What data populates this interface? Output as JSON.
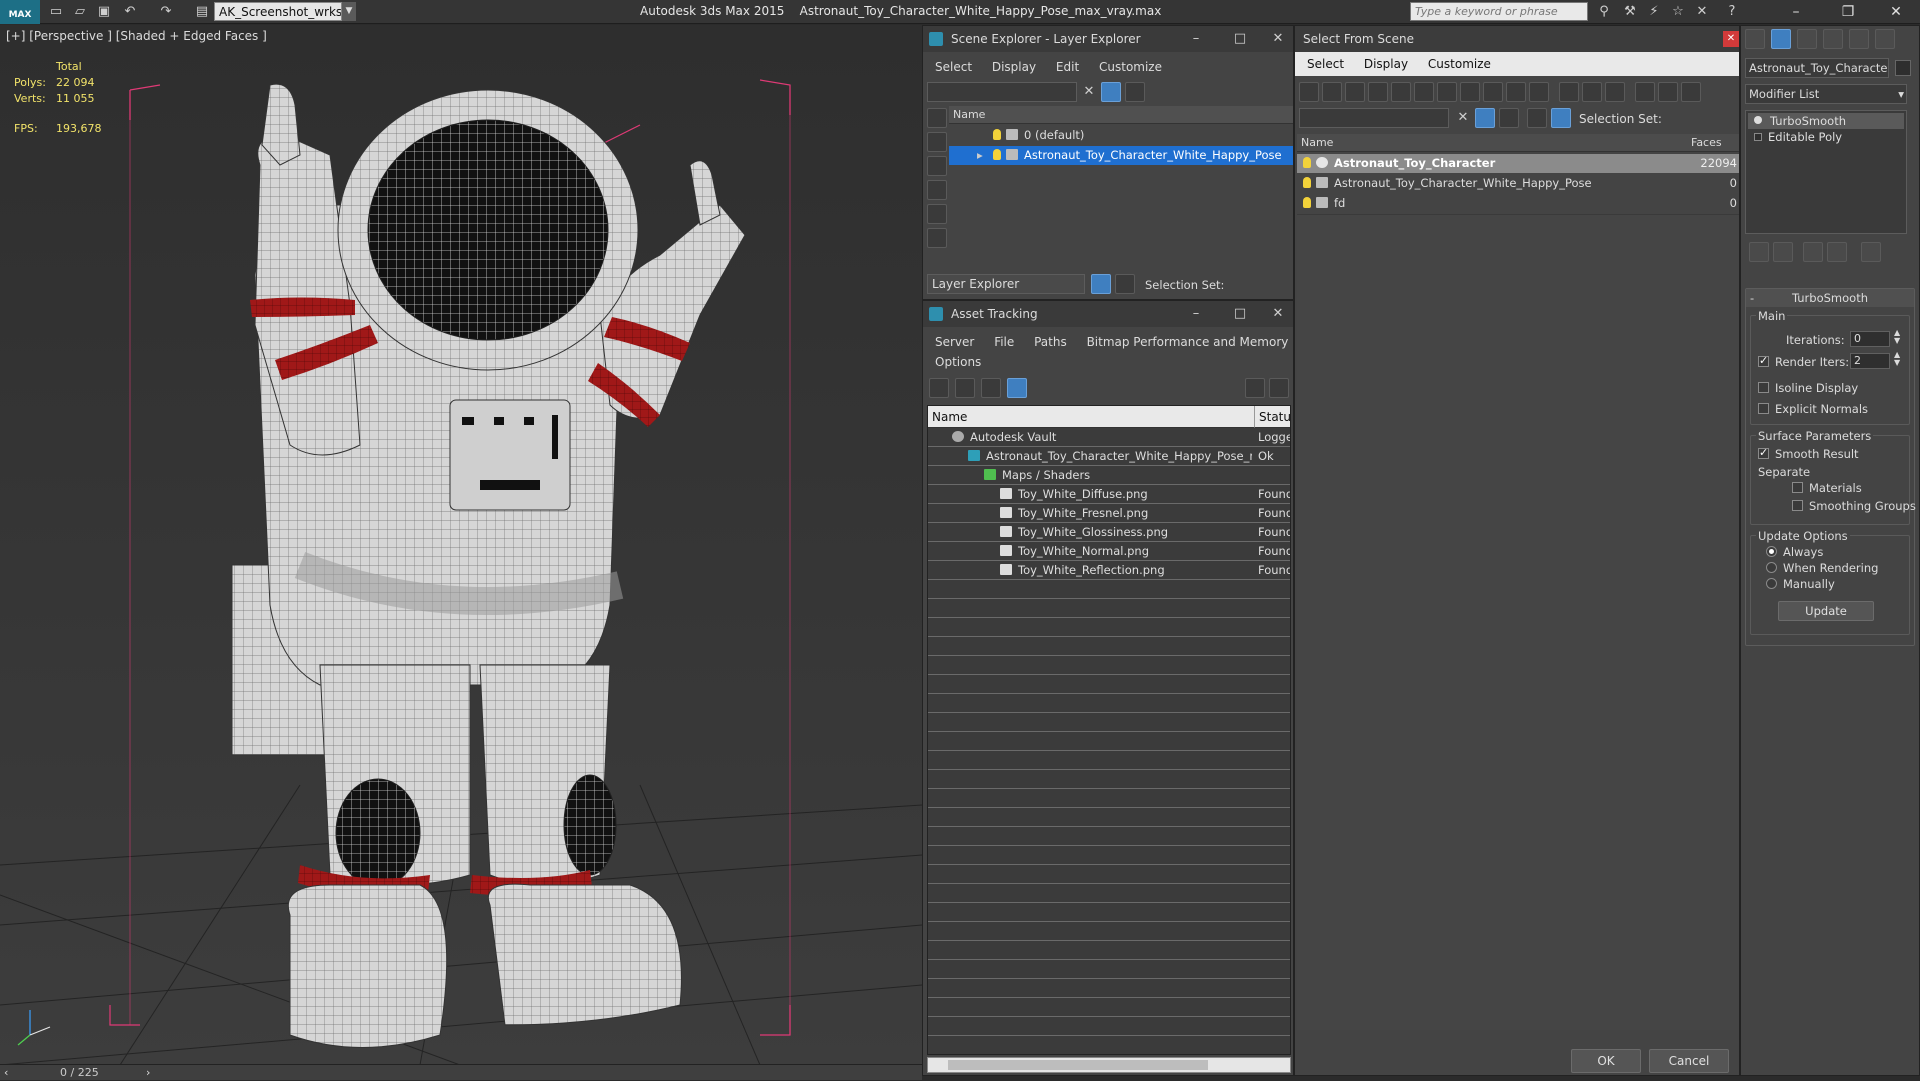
{
  "titlebar": {
    "logo": "MAX",
    "workspace": "AK_Screenshot_wrksp",
    "app": "Autodesk 3ds Max  2015",
    "file": "Astronaut_Toy_Character_White_Happy_Pose_max_vray.max",
    "search_placeholder": "Type a keyword or phrase"
  },
  "viewport": {
    "label": "[+] [Perspective ] [Shaded + Edged Faces ]",
    "stats": {
      "total_label": "Total",
      "polys_label": "Polys:",
      "polys": "22 094",
      "verts_label": "Verts:",
      "verts": "11 055",
      "fps_label": "FPS:",
      "fps": "193,678"
    },
    "timeline": "0 / 225"
  },
  "scene_explorer": {
    "title": "Scene Explorer - Layer Explorer",
    "menu": [
      "Select",
      "Display",
      "Edit",
      "Customize"
    ],
    "col_name": "Name",
    "rows": [
      {
        "label": "0 (default)"
      },
      {
        "label": "Astronaut_Toy_Character_White_Happy_Pose"
      }
    ],
    "footer_label": "Layer Explorer",
    "selection_set": "Selection Set:"
  },
  "asset_tracking": {
    "title": "Asset Tracking",
    "menu": [
      "Server",
      "File",
      "Paths",
      "Bitmap Performance and Memory",
      "Options"
    ],
    "col_name": "Name",
    "col_status": "Status",
    "rows": [
      {
        "name": "Autodesk Vault",
        "status": "Logged"
      },
      {
        "name": "Astronaut_Toy_Character_White_Happy_Pose_m...",
        "status": "Ok"
      },
      {
        "name": "Maps / Shaders",
        "status": ""
      },
      {
        "name": "Toy_White_Diffuse.png",
        "status": "Found"
      },
      {
        "name": "Toy_White_Fresnel.png",
        "status": "Found"
      },
      {
        "name": "Toy_White_Glossiness.png",
        "status": "Found"
      },
      {
        "name": "Toy_White_Normal.png",
        "status": "Found"
      },
      {
        "name": "Toy_White_Reflection.png",
        "status": "Found"
      }
    ]
  },
  "select_from_scene": {
    "title": "Select From Scene",
    "menu": [
      "Select",
      "Display",
      "Customize"
    ],
    "selection_set": "Selection Set:",
    "col_name": "Name",
    "col_faces": "Faces",
    "rows": [
      {
        "name": "Astronaut_Toy_Character",
        "faces": "22094"
      },
      {
        "name": "Astronaut_Toy_Character_White_Happy_Pose",
        "faces": "0"
      },
      {
        "name": "fd",
        "faces": "0"
      }
    ],
    "ok": "OK",
    "cancel": "Cancel"
  },
  "modify_panel": {
    "object_name": "Astronaut_Toy_Character",
    "modifier_list": "Modifier List",
    "stack": [
      "TurboSmooth",
      "Editable Poly"
    ],
    "rollout_title": "TurboSmooth",
    "main_label": "Main",
    "iterations_label": "Iterations:",
    "iterations": "0",
    "render_iters_label": "Render Iters:",
    "render_iters": "2",
    "isoline": "Isoline Display",
    "explicit_normals": "Explicit Normals",
    "surface_params": "Surface Parameters",
    "smooth_result": "Smooth Result",
    "separate": "Separate",
    "materials": "Materials",
    "smoothing_groups": "Smoothing Groups",
    "update_options": "Update Options",
    "always": "Always",
    "when_rendering": "When Rendering",
    "manually": "Manually",
    "update_btn": "Update"
  }
}
